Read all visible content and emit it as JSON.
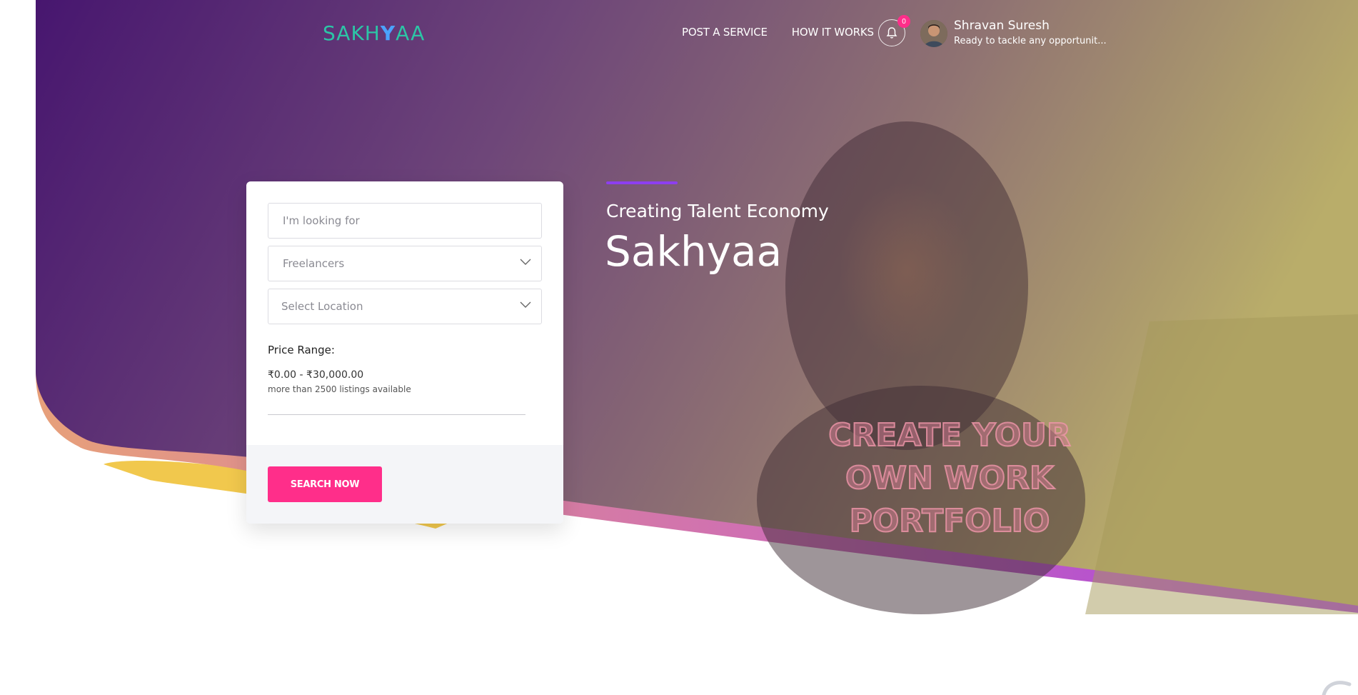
{
  "brand": {
    "logo_prefix": "SAKH",
    "logo_y": "Y",
    "logo_suffix": "AA"
  },
  "nav": {
    "post_service": "POST A SERVICE",
    "how_it_works": "HOW IT WORKS"
  },
  "notifications": {
    "count": "0"
  },
  "user": {
    "name": "Shravan Suresh",
    "tagline": "Ready to tackle any opportunit..."
  },
  "hero": {
    "tagline": "Creating Talent Economy",
    "title": "Sakhyaa",
    "promo_line1": "CREATE YOUR",
    "promo_line2": "OWN WORK PORTFOLIO"
  },
  "search": {
    "keyword_placeholder": "I'm looking for",
    "category_selected": "Freelancers",
    "location_selected": "Select Location",
    "price_label": "Price Range:",
    "price_value": "₹0.00 - ₹30,000.00",
    "listings_note": "more than 2500 listings available",
    "button_label": "SEARCH NOW"
  },
  "colors": {
    "hero_purple": "#4a1a78",
    "accent_pink": "#ff2e8a",
    "accent_purple": "#8d3ef0",
    "logo_teal": "#2cc5a6"
  }
}
